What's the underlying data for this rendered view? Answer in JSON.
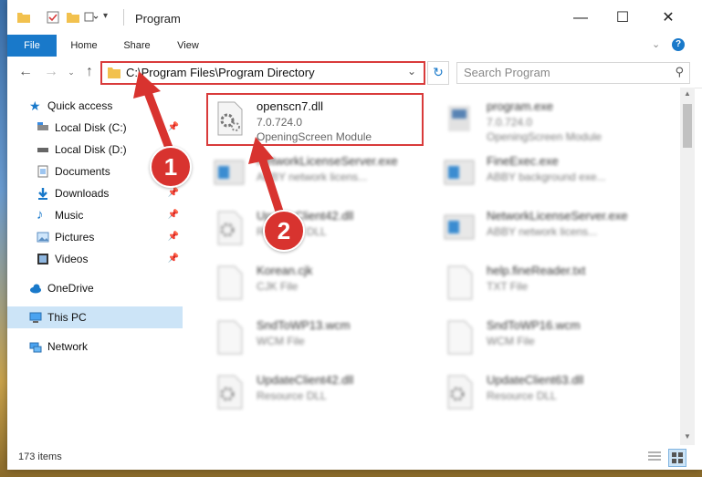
{
  "window": {
    "title": "Program",
    "controls": {
      "minimize": "—",
      "maximize": "☐",
      "close": "✕"
    }
  },
  "ribbon": {
    "tabs": [
      {
        "label": "File"
      },
      {
        "label": "Home"
      },
      {
        "label": "Share"
      },
      {
        "label": "View"
      }
    ]
  },
  "address": {
    "path": "C:\\Program Files\\Program Directory"
  },
  "search": {
    "placeholder": "Search Program"
  },
  "sidebar": {
    "items": [
      {
        "label": "Quick access",
        "icon": "star-icon"
      },
      {
        "label": "Local Disk (C:)",
        "icon": "drive-icon",
        "pinned": true
      },
      {
        "label": "Local Disk (D:)",
        "icon": "drive-icon"
      },
      {
        "label": "Documents",
        "icon": "documents-icon",
        "pinned": true
      },
      {
        "label": "Downloads",
        "icon": "download-icon",
        "pinned": true
      },
      {
        "label": "Music",
        "icon": "music-icon",
        "pinned": true
      },
      {
        "label": "Pictures",
        "icon": "pictures-icon",
        "pinned": true
      },
      {
        "label": "Videos",
        "icon": "video-icon",
        "pinned": true
      },
      {
        "label": "OneDrive",
        "icon": "cloud-icon"
      },
      {
        "label": "This PC",
        "icon": "computer-icon",
        "selected": true
      },
      {
        "label": "Network",
        "icon": "network-icon"
      }
    ]
  },
  "files": [
    {
      "name": "openscn7.dll",
      "sub1": "7.0.724.0",
      "sub2": "OpeningScreen Module",
      "icon": "dll-gear-icon",
      "highlight": true
    },
    {
      "name": "program.exe",
      "sub1": "7.0.724.0",
      "sub2": "OpeningScreen Module",
      "icon": "exe-icon"
    },
    {
      "name": "NetworkLicenseServer.exe",
      "sub1": "ABBY network licens...",
      "icon": "app-window-icon"
    },
    {
      "name": "FineExec.exe",
      "sub1": "ABBY background exe...",
      "icon": "app-window-icon"
    },
    {
      "name": "UpdateClient42.dll",
      "sub1": "Resource DLL",
      "icon": "dll-gear-icon"
    },
    {
      "name": "NetworkLicenseServer.exe",
      "sub1": "ABBY network licens...",
      "icon": "app-window-icon"
    },
    {
      "name": "Korean.cjk",
      "sub1": "CJK File",
      "icon": "file-icon"
    },
    {
      "name": "help.fineReader.txt",
      "sub1": "TXT File",
      "icon": "file-icon"
    },
    {
      "name": "SndToWP13.wcm",
      "sub1": "WCM File",
      "icon": "file-icon"
    },
    {
      "name": "SndToWP16.wcm",
      "sub1": "WCM File",
      "icon": "file-icon"
    },
    {
      "name": "UpdateClient42.dll",
      "sub1": "Resource DLL",
      "icon": "dll-gear-icon"
    },
    {
      "name": "UpdateClient63.dll",
      "sub1": "Resource DLL",
      "icon": "dll-gear-icon"
    }
  ],
  "status": {
    "count": "173 items"
  },
  "annotations": {
    "step1": "1",
    "step2": "2",
    "color": "#d8332f"
  }
}
